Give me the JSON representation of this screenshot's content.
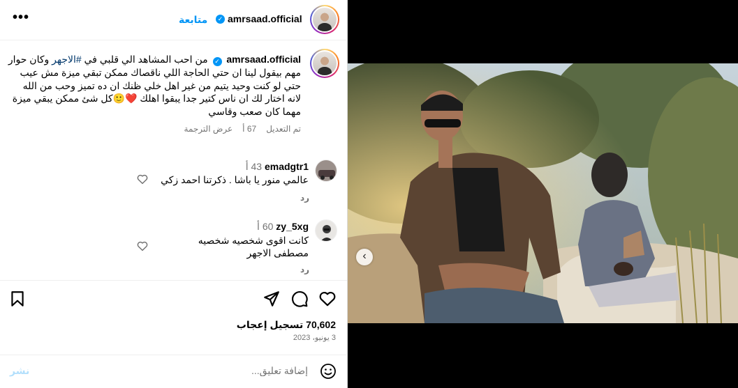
{
  "header": {
    "username": "amrsaad.official",
    "follow_label": "متابعة",
    "more_icon": "more-options-icon"
  },
  "caption": {
    "username": "amrsaad.official",
    "text_before_tag": "من احب المشاهد الي قلبي في ",
    "hashtag": "#الاجهر",
    "text_after_tag": " وكان حوار مهم بيقول لينا ان حتي الحاجة اللي ناقصاك ممكن تبقي ميزة مش عيب حتي لو كنت وحيد يتيم من غير اهل خلي ظنك ان ده تميز وحب من الله لانه اختار لك ان ناس كتير جدا يبقوا اهلك ",
    "emoji_heart": "❤️",
    "emoji_smile": "🙂",
    "text_end": "كل شئ ممكن يبقي ميزة مهما كان صعب وقاسي",
    "edited": "تم التعديل",
    "edited_time": "67 أ",
    "see_translation": "عرض الترجمة"
  },
  "comments": [
    {
      "username": "emadgtr1",
      "time": "43 أ",
      "text": "عالمي منور يا باشا . ذكرتنا احمد زكي",
      "reply": "رد"
    },
    {
      "username": "zy_5xg",
      "time": "60 أ",
      "text_line1": "كانت اقوى شخصيه شخصيه",
      "text_line2": "مصطفى الاجهر",
      "reply": "رد"
    }
  ],
  "actions": {
    "likes": "70,602 تسجيل إعجاب",
    "date": "3 يونيو، 2023"
  },
  "composer": {
    "placeholder": "إضافة تعليق...",
    "post_label": "نشر"
  },
  "carousel": {
    "total": 2,
    "active_index": 2
  },
  "colors": {
    "accent": "#0095f6",
    "heart_red": "#ed4956"
  }
}
